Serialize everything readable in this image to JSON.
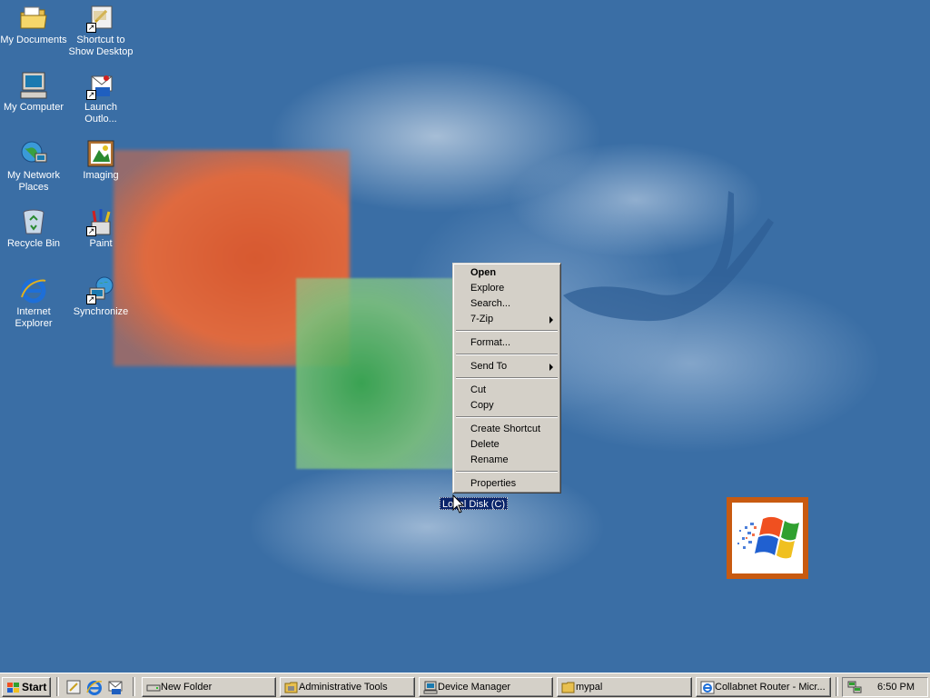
{
  "desktop": {
    "icons": [
      {
        "label": "My Documents",
        "icon": "my-documents-icon"
      },
      {
        "label": "Shortcut to Show Desktop",
        "icon": "show-desktop-icon"
      },
      {
        "label": "My Computer",
        "icon": "my-computer-icon"
      },
      {
        "label": "Launch Outlo...",
        "icon": "outlook-icon"
      },
      {
        "label": "My Network Places",
        "icon": "network-places-icon"
      },
      {
        "label": "Imaging",
        "icon": "imaging-icon"
      },
      {
        "label": "Recycle Bin",
        "icon": "recycle-bin-icon"
      },
      {
        "label": "Paint",
        "icon": "paint-icon"
      },
      {
        "label": "Internet Explorer",
        "icon": "internet-explorer-icon"
      },
      {
        "label": "Synchronize",
        "icon": "synchronize-icon"
      }
    ],
    "selected_item_label": "Local Disk (C)"
  },
  "context_menu": {
    "items": [
      {
        "label": "Open",
        "bold": true
      },
      {
        "label": "Explore"
      },
      {
        "label": "Search..."
      },
      {
        "label": "7-Zip",
        "submenu": true
      },
      {
        "label": "Format..."
      },
      {
        "label": "Send To",
        "submenu": true
      },
      {
        "label": "Cut"
      },
      {
        "label": "Copy"
      },
      {
        "label": "Create Shortcut"
      },
      {
        "label": "Delete"
      },
      {
        "label": "Rename"
      },
      {
        "label": "Properties"
      }
    ]
  },
  "taskbar": {
    "start_label": "Start",
    "quick_launch": [
      "show-desktop-icon",
      "internet-explorer-icon",
      "outlook-icon"
    ],
    "tasks": [
      {
        "label": "New Folder",
        "icon": "drive-icon"
      },
      {
        "label": "Administrative Tools",
        "icon": "folder-tools-icon"
      },
      {
        "label": "Device Manager",
        "icon": "device-manager-icon"
      },
      {
        "label": "mypal",
        "icon": "folder-icon"
      },
      {
        "label": "Collabnet Router - Micr...",
        "icon": "internet-explorer-icon"
      }
    ],
    "clock": "6:50 PM"
  },
  "colors": {
    "desktop_background": "#3a6ea5",
    "face": "#d4d0c8",
    "highlight": "#0a246a",
    "logo_frame": "#c85a10"
  }
}
